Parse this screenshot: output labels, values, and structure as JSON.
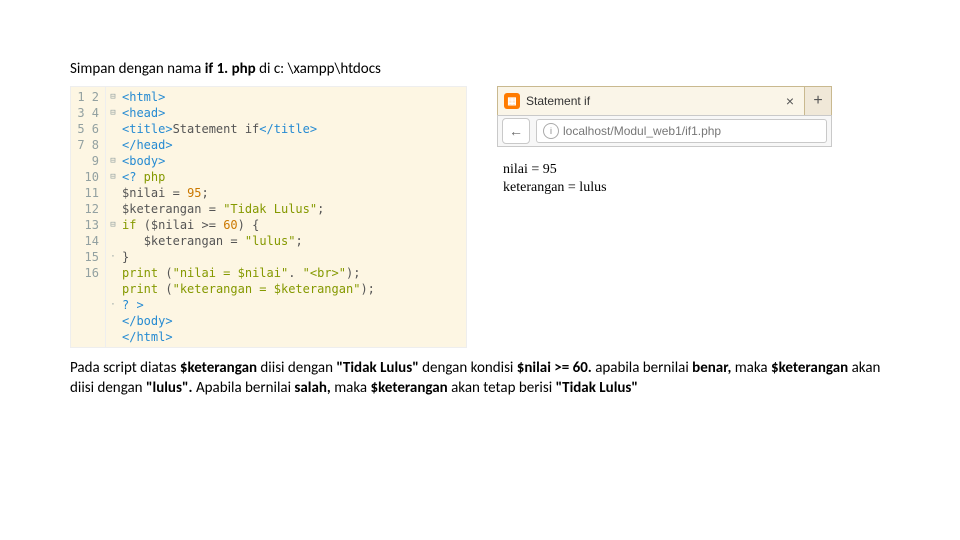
{
  "heading": {
    "pre": "Simpan dengan nama ",
    "filename": "if 1. php",
    "post": " di c: \\xampp\\htdocs"
  },
  "code": {
    "lines": [
      "<html>",
      "<head>",
      "<title>Statement if</title>",
      "</head>",
      "<body>",
      "<? php",
      "$nilai = 95;",
      "$keterangan = \"Tidak Lulus\";",
      "if ($nilai >= 60) {",
      "   $keterangan = \"lulus\";",
      "}",
      "print (\"nilai = $nilai\". \"<br>\");",
      "print (\"keterangan = $keterangan\");",
      "? >",
      "</body>",
      "</html>"
    ],
    "fold": [
      "⊟",
      "⊟",
      "",
      "",
      "⊟",
      "⊟",
      "",
      "",
      "⊟",
      "",
      "·",
      "",
      "",
      "·",
      "",
      ""
    ]
  },
  "browser": {
    "tab_title": "Statement if",
    "url": "localhost/Modul_web1/if1.php",
    "output_line1": "nilai = 95",
    "output_line2": "keterangan = lulus"
  },
  "paragraph": {
    "p1a": "Pada script diatas ",
    "p1b": "$keterangan",
    "p1c": " diisi dengan ",
    "p1d": "\"Tidak Lulus\"",
    "p1e": " dengan kondisi ",
    "p1f": "$nilai >= 60.",
    "p1g": " apabila bernilai ",
    "p1h": "benar,",
    "p1i": " maka ",
    "p1j": "$keterangan",
    "p1k": " akan diisi dengan ",
    "p1l": "\"lulus\".",
    "p1m": " Apabila bernilai ",
    "p1n": "salah,",
    "p1o": " maka ",
    "p1p": "$keterangan",
    "p1q": " akan tetap berisi ",
    "p1r": "\"Tidak Lulus\""
  }
}
